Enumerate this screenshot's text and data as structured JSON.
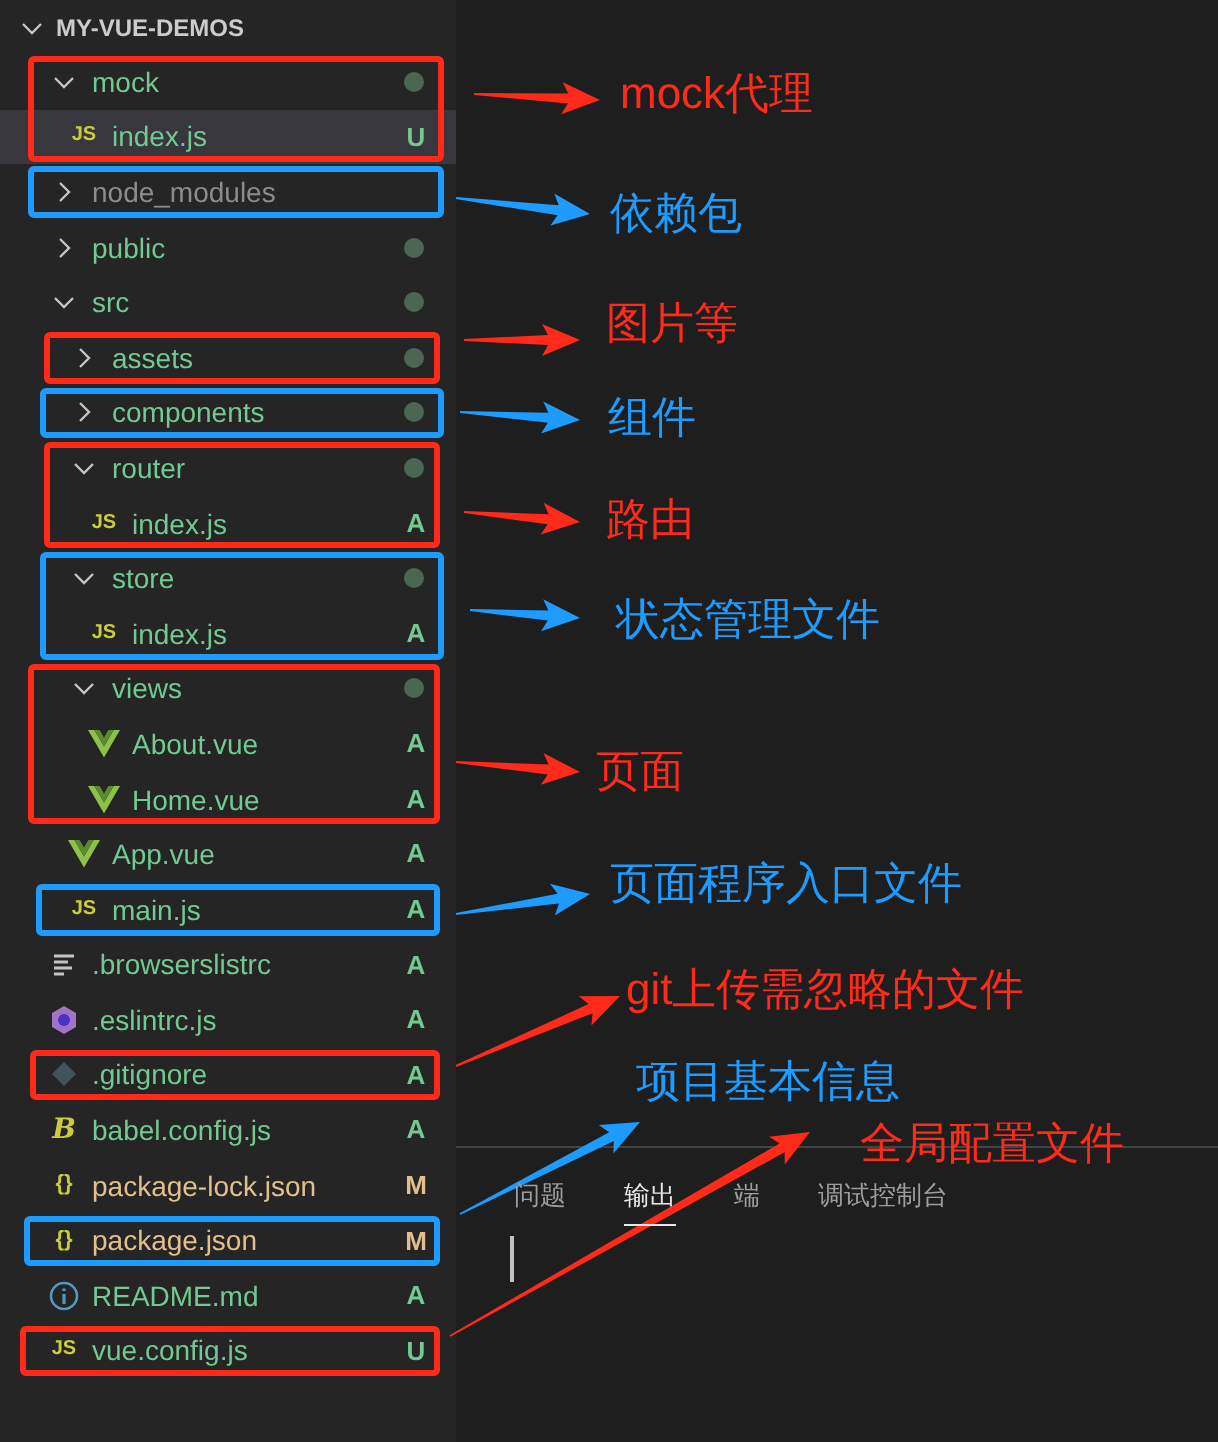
{
  "explorer": {
    "title": "MY-VUE-DEMOS",
    "expanded": true
  },
  "tree": [
    {
      "name": "mock",
      "kind": "folder",
      "expanded": true,
      "color": "#73c991",
      "has_changes": true,
      "selected": false,
      "annotation": {
        "label": "mock代理",
        "color": "#ff2a1a"
      },
      "children": [
        {
          "name": "index.js",
          "kind": "js",
          "icon_text": "JS",
          "color": "#73c991",
          "status": "U",
          "selected": true
        }
      ]
    },
    {
      "name": "node_modules",
      "kind": "folder",
      "expanded": false,
      "color": "#8c8c8c",
      "has_changes": false,
      "selected": false,
      "annotation": {
        "label": "依赖包",
        "color": "#1e9bff"
      }
    },
    {
      "name": "public",
      "kind": "folder",
      "expanded": false,
      "color": "#73c991",
      "has_changes": true,
      "selected": false
    },
    {
      "name": "src",
      "kind": "folder",
      "expanded": true,
      "color": "#73c991",
      "has_changes": true,
      "selected": false,
      "children": [
        {
          "name": "assets",
          "kind": "folder",
          "expanded": false,
          "color": "#73c991",
          "has_changes": true,
          "selected": false,
          "annotation": {
            "label": "图片等",
            "color": "#ff2a1a"
          }
        },
        {
          "name": "components",
          "kind": "folder",
          "expanded": false,
          "color": "#73c991",
          "has_changes": true,
          "selected": false,
          "annotation": {
            "label": "组件",
            "color": "#1e9bff"
          }
        },
        {
          "name": "router",
          "kind": "folder",
          "expanded": true,
          "color": "#73c991",
          "has_changes": true,
          "selected": false,
          "annotation": {
            "label": "路由",
            "color": "#ff2a1a"
          },
          "children": [
            {
              "name": "index.js",
              "kind": "js",
              "icon_text": "JS",
              "color": "#73c991",
              "status": "A",
              "selected": false
            }
          ]
        },
        {
          "name": "store",
          "kind": "folder",
          "expanded": true,
          "color": "#73c991",
          "has_changes": true,
          "selected": false,
          "annotation": {
            "label": "状态管理文件",
            "color": "#1e9bff"
          },
          "children": [
            {
              "name": "index.js",
              "kind": "js",
              "icon_text": "JS",
              "color": "#73c991",
              "status": "A",
              "selected": false
            }
          ]
        },
        {
          "name": "views",
          "kind": "folder",
          "expanded": true,
          "color": "#73c991",
          "has_changes": true,
          "selected": false,
          "annotation": {
            "label": "页面",
            "color": "#ff2a1a"
          },
          "children": [
            {
              "name": "About.vue",
              "kind": "vue",
              "color": "#73c991",
              "status": "A",
              "selected": false
            },
            {
              "name": "Home.vue",
              "kind": "vue",
              "color": "#73c991",
              "status": "A",
              "selected": false
            }
          ]
        },
        {
          "name": "App.vue",
          "kind": "vue",
          "color": "#73c991",
          "status": "A",
          "selected": false
        },
        {
          "name": "main.js",
          "kind": "js",
          "icon_text": "JS",
          "color": "#73c991",
          "status": "A",
          "selected": false,
          "annotation": {
            "label": "页面程序入口文件",
            "color": "#1e9bff"
          }
        }
      ]
    },
    {
      "name": ".browserslistrc",
      "kind": "lines",
      "color": "#73c991",
      "status": "A",
      "selected": false
    },
    {
      "name": ".eslintrc.js",
      "kind": "eslint",
      "color": "#73c991",
      "status": "A",
      "selected": false
    },
    {
      "name": ".gitignore",
      "kind": "git",
      "color": "#73c991",
      "status": "A",
      "selected": false,
      "annotation": {
        "label": "git上传需忽略的文件",
        "color": "#ff2a1a"
      }
    },
    {
      "name": "babel.config.js",
      "kind": "babel",
      "icon_text": "B",
      "color": "#73c991",
      "status": "A",
      "selected": false
    },
    {
      "name": "package-lock.json",
      "kind": "json",
      "icon_text": "{}",
      "color": "#e2c08d",
      "status": "M",
      "selected": false
    },
    {
      "name": "package.json",
      "kind": "json",
      "icon_text": "{}",
      "color": "#e2c08d",
      "status": "M",
      "selected": false,
      "annotation": {
        "label": "项目基本信息",
        "color": "#1e9bff"
      }
    },
    {
      "name": "README.md",
      "kind": "info",
      "color": "#73c991",
      "status": "A",
      "selected": false
    },
    {
      "name": "vue.config.js",
      "kind": "js",
      "icon_text": "JS",
      "color": "#73c991",
      "status": "U",
      "selected": false,
      "annotation": {
        "label": "全局配置文件",
        "color": "#ff2a1a"
      }
    }
  ],
  "panel": {
    "tabs": [
      {
        "label": "问题",
        "selected": false
      },
      {
        "label": "输出",
        "selected": true
      },
      {
        "label": "端",
        "selected": false
      },
      {
        "label": "调试控制台",
        "selected": false
      }
    ]
  }
}
